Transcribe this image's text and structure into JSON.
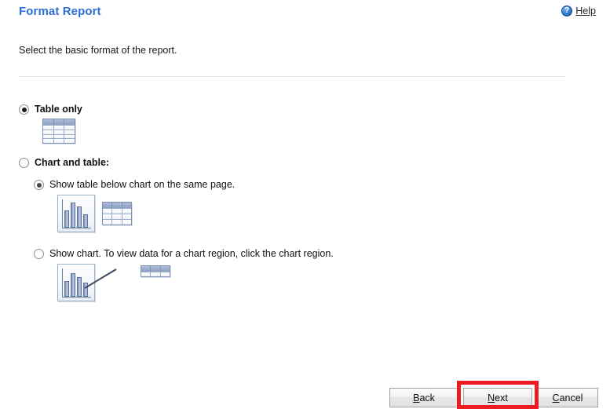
{
  "header": {
    "title": "Format Report",
    "help_label": "Help",
    "help_accesskey": "H",
    "help_icon": "question-circle-icon",
    "title_color": "#2b6fd4"
  },
  "instruction": "Select the basic format of the report.",
  "options": {
    "table_only": {
      "label": "Table only",
      "selected": true,
      "icon": "table-icon"
    },
    "chart_and_table": {
      "label": "Chart and table:",
      "selected": false,
      "sub_options": [
        {
          "label": "Show table below chart on the same page.",
          "selected": true,
          "icon": "chart-and-table-icon"
        },
        {
          "label": "Show chart. To view data for a chart region, click the chart region.",
          "selected": false,
          "icon": "chart-with-callout-table-icon"
        }
      ]
    }
  },
  "footer": {
    "back": {
      "label": "Back",
      "accesskey": "B"
    },
    "next": {
      "label": "Next",
      "accesskey": "N",
      "highlighted": true
    },
    "cancel": {
      "label": "Cancel",
      "accesskey": "C"
    },
    "highlight_color": "#ed1c24"
  }
}
